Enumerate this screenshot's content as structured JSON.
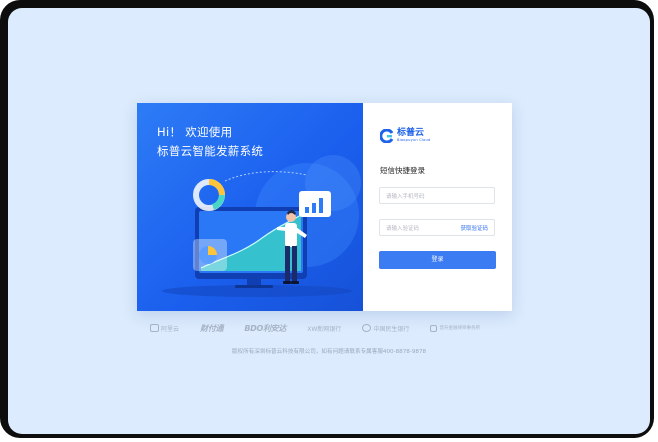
{
  "hero": {
    "line1": "Hi！ 欢迎使用",
    "line2": "标普云智能发薪系统"
  },
  "logo": {
    "name": "标普云",
    "sub": "Biaopuyun Cloud"
  },
  "login": {
    "title": "短信快捷登录",
    "phone_placeholder": "请输入手机号码",
    "code_placeholder": "请输入验证码",
    "get_code_label": "获取验证码",
    "submit_label": "登录"
  },
  "partners": [
    {
      "label": "阿里云",
      "icon": "cloud-icon"
    },
    {
      "label": "财付通",
      "icon": "wallet-icon"
    },
    {
      "label": "BDO利安达",
      "icon": "bdo-logo"
    },
    {
      "label": "XW新网银行",
      "icon": "bank-logo"
    },
    {
      "label": "中国民生银行",
      "icon": "bank-logo"
    },
    {
      "label": "晋升金融律师事务所",
      "icon": "lawfirm-logo"
    }
  ],
  "footer": {
    "copyright": "版权所有深圳标普云科技有限公司，如有问题请联系专属客服400-8878-9878"
  },
  "colors": {
    "accent": "#3b7cf2",
    "background": "#dcebfd",
    "hero": "#1f63e8"
  }
}
